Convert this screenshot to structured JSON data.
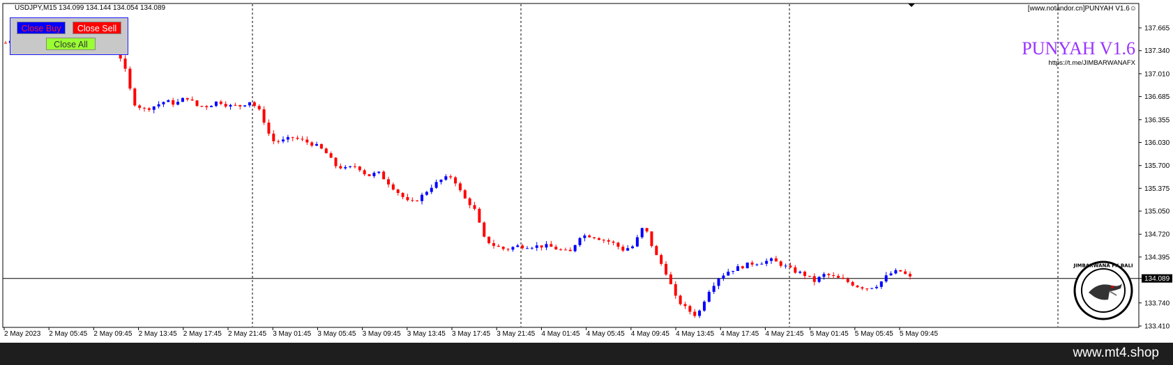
{
  "chart_header": {
    "symbol_info": "USDJPY,M15  134.099 134.144 134.054 134.089",
    "indicator_label": "[www.notandor.cn]PUNYAH V1.6",
    "indicator_icon": "smiley-icon"
  },
  "watermark": {
    "title": "PUNYAH V1.6",
    "link": "https://t.me/JIMBARWANAFX"
  },
  "trade_panel": {
    "close_buy": "Close Buy",
    "close_sell": "Close Sell",
    "close_all": "Close All"
  },
  "price_scale": {
    "labels": [
      "137.665",
      "137.340",
      "137.010",
      "136.685",
      "136.355",
      "136.030",
      "135.700",
      "135.375",
      "135.050",
      "134.720",
      "134.395",
      "134.089",
      "133.740",
      "133.410"
    ],
    "current_price": "134.089"
  },
  "time_scale": {
    "labels": [
      "2 May 2023",
      "2 May 05:45",
      "2 May 09:45",
      "2 May 13:45",
      "2 May 17:45",
      "2 May 21:45",
      "3 May 01:45",
      "3 May 05:45",
      "3 May 09:45",
      "3 May 13:45",
      "3 May 17:45",
      "3 May 21:45",
      "4 May 01:45",
      "4 May 05:45",
      "4 May 09:45",
      "4 May 13:45",
      "4 May 17:45",
      "4 May 21:45",
      "5 May 01:45",
      "5 May 05:45",
      "5 May 09:45"
    ]
  },
  "logo": {
    "text": "JIMBARWANA FX BALI",
    "icon": "bird-logo-icon"
  },
  "footer": {
    "site": "www.mt4.shop"
  },
  "colors": {
    "bull": "#0000ff",
    "bear": "#ff0000",
    "accent": "#9933ff"
  },
  "chart_data": {
    "type": "candlestick",
    "title": "USDJPY,M15",
    "ylim": [
      133.41,
      137.665
    ],
    "current_price": 134.089,
    "x": [
      "2 May 2023",
      "2 May 05:45",
      "2 May 09:45",
      "2 May 13:45",
      "2 May 17:45",
      "2 May 21:45",
      "3 May 01:45",
      "3 May 05:45",
      "3 May 09:45",
      "3 May 13:45",
      "3 May 17:45",
      "3 May 21:45",
      "4 May 01:45",
      "4 May 05:45",
      "4 May 09:45",
      "4 May 13:45",
      "4 May 17:45",
      "4 May 21:45",
      "5 May 01:45",
      "5 May 05:45",
      "5 May 09:45"
    ],
    "close_path": [
      137.45,
      137.55,
      137.48,
      137.5,
      137.55,
      137.45,
      137.4,
      137.5,
      137.6,
      137.58,
      137.4,
      137.2,
      136.6,
      136.5,
      136.55,
      136.62,
      136.58,
      136.68,
      136.55,
      136.55,
      136.62,
      136.55,
      136.55,
      136.62,
      136.45,
      136.05,
      136.05,
      136.1,
      136.05,
      136.0,
      135.9,
      135.7,
      135.65,
      135.7,
      135.55,
      135.6,
      135.45,
      135.3,
      135.15,
      135.25,
      135.4,
      135.5,
      135.55,
      135.25,
      135.1,
      134.65,
      134.55,
      134.5,
      134.55,
      134.55,
      134.55,
      134.55,
      134.5,
      134.45,
      134.7,
      134.7,
      134.65,
      134.6,
      134.5,
      134.55,
      134.85,
      134.45,
      134.2,
      133.8,
      133.65,
      133.55,
      133.9,
      134.1,
      134.2,
      134.25,
      134.3,
      134.32,
      134.35,
      134.28,
      134.2,
      134.15,
      134.05,
      134.15,
      134.1,
      134.05,
      133.98,
      133.95,
      134.0,
      134.15,
      134.2,
      134.1
    ]
  }
}
